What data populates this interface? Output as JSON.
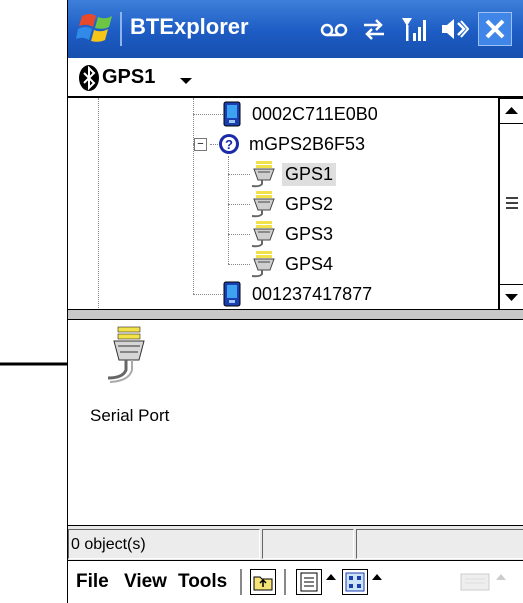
{
  "titlebar": {
    "title": "BTExplorer",
    "icons": [
      "windows-flag-icon",
      "voicemail-icon",
      "sync-icon",
      "signal-icon",
      "speaker-icon"
    ],
    "close_icon": "close-icon"
  },
  "selector": {
    "icon": "bluetooth-icon",
    "label": "GPS1"
  },
  "tree": {
    "items": [
      {
        "label": "0002C711E0B0",
        "icon": "pda-device-icon",
        "selected": false
      },
      {
        "label": "mGPS2B6F53",
        "icon": "question-device-icon",
        "selected": false,
        "expanded": true
      },
      {
        "label": "GPS1",
        "icon": "serial-port-icon",
        "selected": true
      },
      {
        "label": "GPS2",
        "icon": "serial-port-icon",
        "selected": false
      },
      {
        "label": "GPS3",
        "icon": "serial-port-icon",
        "selected": false
      },
      {
        "label": "GPS4",
        "icon": "serial-port-icon",
        "selected": false
      },
      {
        "label": "001237417877",
        "icon": "pda-device-icon",
        "selected": false
      }
    ]
  },
  "content": {
    "items": [
      {
        "label": "Serial Port",
        "icon": "serial-port-icon"
      }
    ]
  },
  "statusbar": {
    "count_text": "0 object(s)"
  },
  "menubar": {
    "file": "File",
    "view": "View",
    "tools": "Tools"
  },
  "colors": {
    "titlebar": "#1d5cc4",
    "selected_bg": "#dedede",
    "port_yellow": "#f2e24a"
  }
}
